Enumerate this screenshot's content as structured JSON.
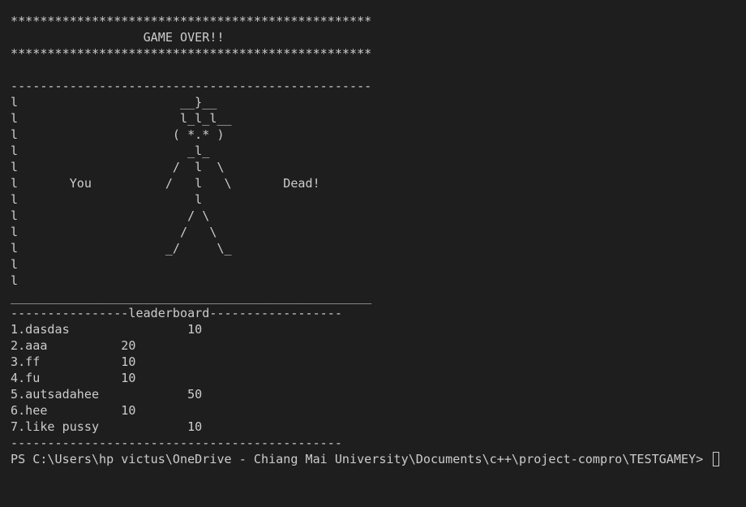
{
  "terminal": {
    "header": [
      "*************************************************",
      "                  GAME OVER!!",
      "*************************************************",
      "",
      "-------------------------------------------------"
    ],
    "art": [
      "l                      __}__",
      "l                      l_l_l__",
      "l                     ( *.* )",
      "l                       _l_",
      "l                     /  l  \\",
      "l       You          /   l   \\       Dead!",
      "l                        l",
      "l                       / \\",
      "l                      /   \\",
      "l                    _/     \\_",
      "l",
      "l"
    ],
    "divider_bottom": "_________________________________________________",
    "leaderboard_title": "----------------leaderboard------------------",
    "leaderboard": [
      "1.dasdas                10",
      "2.aaa          20",
      "3.ff           10",
      "4.fu           10",
      "5.autsadahee            50",
      "6.hee          10",
      "7.like pussy            10"
    ],
    "leaderboard_end": "---------------------------------------------",
    "prompt": "PS C:\\Users\\hp victus\\OneDrive - Chiang Mai University\\Documents\\c++\\project-compro\\TESTGAMEY> "
  }
}
